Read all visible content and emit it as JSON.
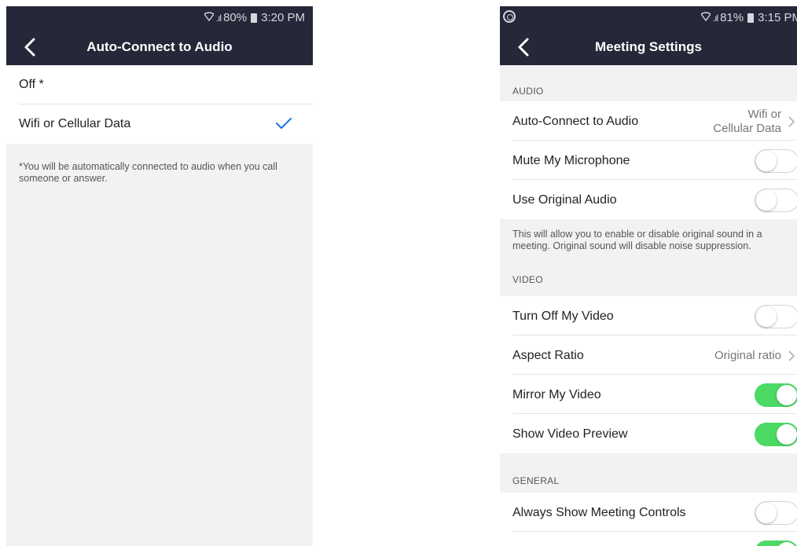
{
  "left": {
    "status": {
      "signal": ".ıl",
      "battery": "80%",
      "time": "3:20 PM"
    },
    "title": "Auto-Connect to Audio",
    "options": [
      {
        "label": "Off *",
        "selected": false
      },
      {
        "label": "Wifi or Cellular Data",
        "selected": true
      }
    ],
    "footnote": "*You will be automatically connected to audio when you call someone or answer."
  },
  "right": {
    "status": {
      "signal": ".ıl",
      "battery": "81%",
      "time": "3:15 PM"
    },
    "title": "Meeting Settings",
    "audio": {
      "header": "AUDIO",
      "auto_connect": {
        "label": "Auto-Connect to Audio",
        "value_line1": "Wifi or",
        "value_line2": "Cellular Data"
      },
      "mute_mic": {
        "label": "Mute My Microphone",
        "on": false
      },
      "original_audio": {
        "label": "Use Original Audio",
        "on": false
      },
      "hint": "This will allow you to enable or disable original sound in a meeting. Original sound will disable noise suppression."
    },
    "video": {
      "header": "VIDEO",
      "turn_off_video": {
        "label": "Turn Off My Video",
        "on": false
      },
      "aspect_ratio": {
        "label": "Aspect Ratio",
        "value": "Original ratio"
      },
      "mirror_video": {
        "label": "Mirror My Video",
        "on": true
      },
      "show_preview": {
        "label": "Show Video Preview",
        "on": true
      }
    },
    "general": {
      "header": "GENERAL",
      "always_show_controls": {
        "label": "Always Show Meeting Controls",
        "on": false
      }
    }
  },
  "colors": {
    "navbar": "#262738",
    "accent_check": "#1a73e8",
    "toggle_on": "#4cd964"
  }
}
